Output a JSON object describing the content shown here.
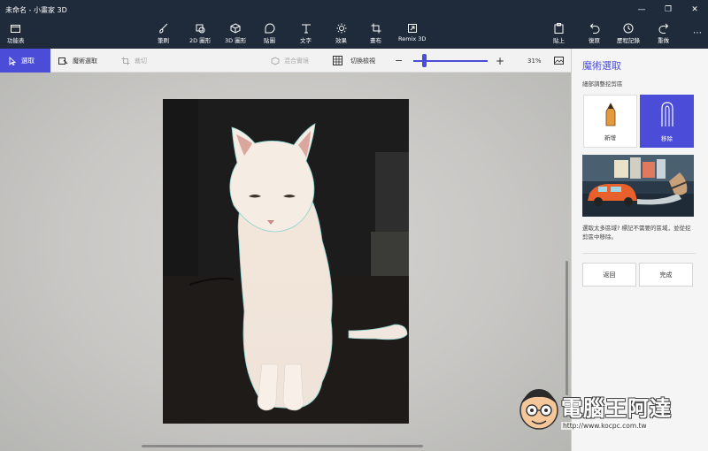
{
  "window": {
    "title": "未命名 - 小畫家 3D"
  },
  "toolbar": {
    "menu": "功能表",
    "brushes": "筆刷",
    "shapes2d": "2D 圖形",
    "shapes3d": "3D 圖形",
    "stickers": "貼圖",
    "text": "文字",
    "effects": "效果",
    "canvas": "畫布",
    "remix": "Remix 3D",
    "paste": "貼上",
    "undo": "復原",
    "history": "歷程記錄",
    "redo": "重做"
  },
  "subbar": {
    "select": "選取",
    "magic_select": "魔術選取",
    "crop": "裁切",
    "mixed_reality": "混合實境",
    "toggle_view": "切換檢視",
    "zoom_percent": "31%",
    "zoom_level": 0.31
  },
  "panel": {
    "title": "魔術選取",
    "subtitle": "細部調整挖剪區",
    "add_label": "新增",
    "remove_label": "移除",
    "description": "選取太多區域? 標記不需要的區域，並從挖剪區中移除。",
    "back_button": "返回",
    "done_button": "完成"
  },
  "watermark": {
    "text": "電腦王阿達",
    "url": "http://www.kocpc.com.tw"
  },
  "colors": {
    "accent": "#4b4dd8",
    "titlebar": "#1f2a3a",
    "panel_bg": "#f5f5f5"
  }
}
